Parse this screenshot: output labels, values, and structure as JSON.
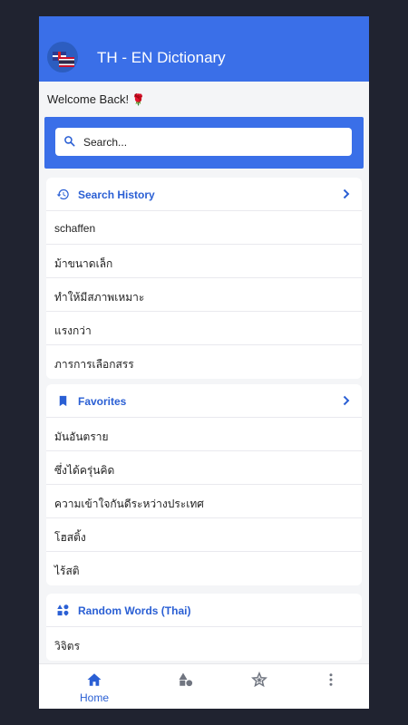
{
  "app": {
    "title": "TH - EN Dictionary",
    "welcome": "Welcome Back!",
    "welcome_emoji_icon": "rose-icon"
  },
  "search": {
    "placeholder": "Search..."
  },
  "sections": {
    "history": {
      "title": "Search History",
      "icon": "history-icon",
      "items": [
        "schaffen",
        "ม้าขนาดเล็ก",
        "ทำให้มีสภาพเหมาะ",
        "แรงกว่า",
        "ภารการเลือกสรร"
      ]
    },
    "favorites": {
      "title": "Favorites",
      "icon": "bookmark-icon",
      "items": [
        "มันอันตราย",
        "ซึ่งได้ครุ่นคิด",
        "ความเข้าใจกันดีระหว่างประเทศ",
        "โฮสติ้ง",
        "ไร้สติ"
      ]
    },
    "random": {
      "title": "Random Words (Thai)",
      "icon": "shapes-icon",
      "items": [
        "วิจิตร"
      ]
    }
  },
  "bottom_nav": {
    "home_label": "Home",
    "items": [
      "home-icon",
      "shapes-icon",
      "star-icon",
      "more-vertical-icon"
    ]
  },
  "colors": {
    "primary": "#3a6fe8",
    "accent_text": "#2a5fd4",
    "background": "#f4f5f7",
    "frame": "#202330"
  }
}
